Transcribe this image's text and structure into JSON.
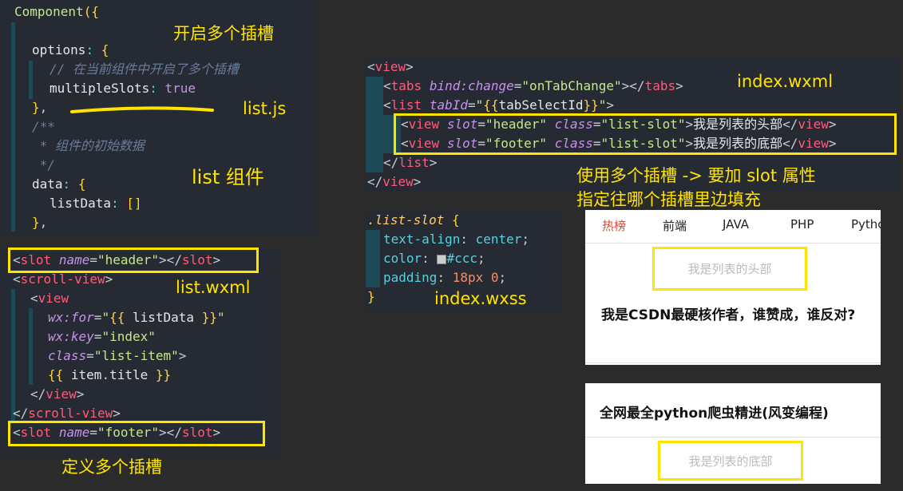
{
  "list_js": {
    "lines": [
      "Component({",
      "  options: {",
      "    // 在当前组件中开启了多个插槽",
      "    multipleSlots: true",
      "  },",
      "  /**",
      "   * 组件的初始数据",
      "   */",
      "  data: {",
      "    listData: []",
      "  },"
    ]
  },
  "list_wxml": {
    "lines": [
      "<slot name=\"header\"></slot>",
      "<scroll-view>",
      "  <view",
      "    wx:for=\"{{ listData }}\"",
      "    wx:key=\"index\"",
      "    class=\"list-item\">",
      "    {{ item.title }}",
      "  </view>",
      "</scroll-view>",
      "<slot name=\"footer\"></slot>"
    ]
  },
  "index_wxml": {
    "lines": [
      "<view>",
      "  <tabs bind:change=\"onTabChange\"></tabs>",
      "  <list tabId=\"{{tabSelectId}}\">",
      "    <view slot=\"header\" class=\"list-slot\">我是列表的头部</view>",
      "    <view slot=\"footer\" class=\"list-slot\">我是列表的底部</view>",
      "  </list>",
      "</view>"
    ]
  },
  "index_wxss": {
    "lines": [
      ".list-slot {",
      "  text-align: center;",
      "  color: #ccc;",
      "  padding: 18px 0;",
      "}"
    ]
  },
  "notes": {
    "open_slots": "开启多个插槽",
    "list_js": "list.js",
    "list_component": "list 组件",
    "list_wxml": "list.wxml",
    "define_slots": "定义多个插槽",
    "index_wxml": "index.wxml",
    "use_slots_1": "使用多个插槽 -> 要加 slot 属性",
    "use_slots_2": "指定往哪个插槽里边填充",
    "index_wxss": "index.wxss"
  },
  "preview": {
    "tabs": [
      "热榜",
      "前端",
      "JAVA",
      "PHP",
      "Pytho"
    ],
    "active_tab_color": "#e8432e",
    "header_slot": "我是列表的头部",
    "item1": "我是CSDN最硬核作者，谁赞成，谁反对?",
    "item2": "全网最全python爬虫精进(风变编程)",
    "footer_slot": "我是列表的底部"
  }
}
